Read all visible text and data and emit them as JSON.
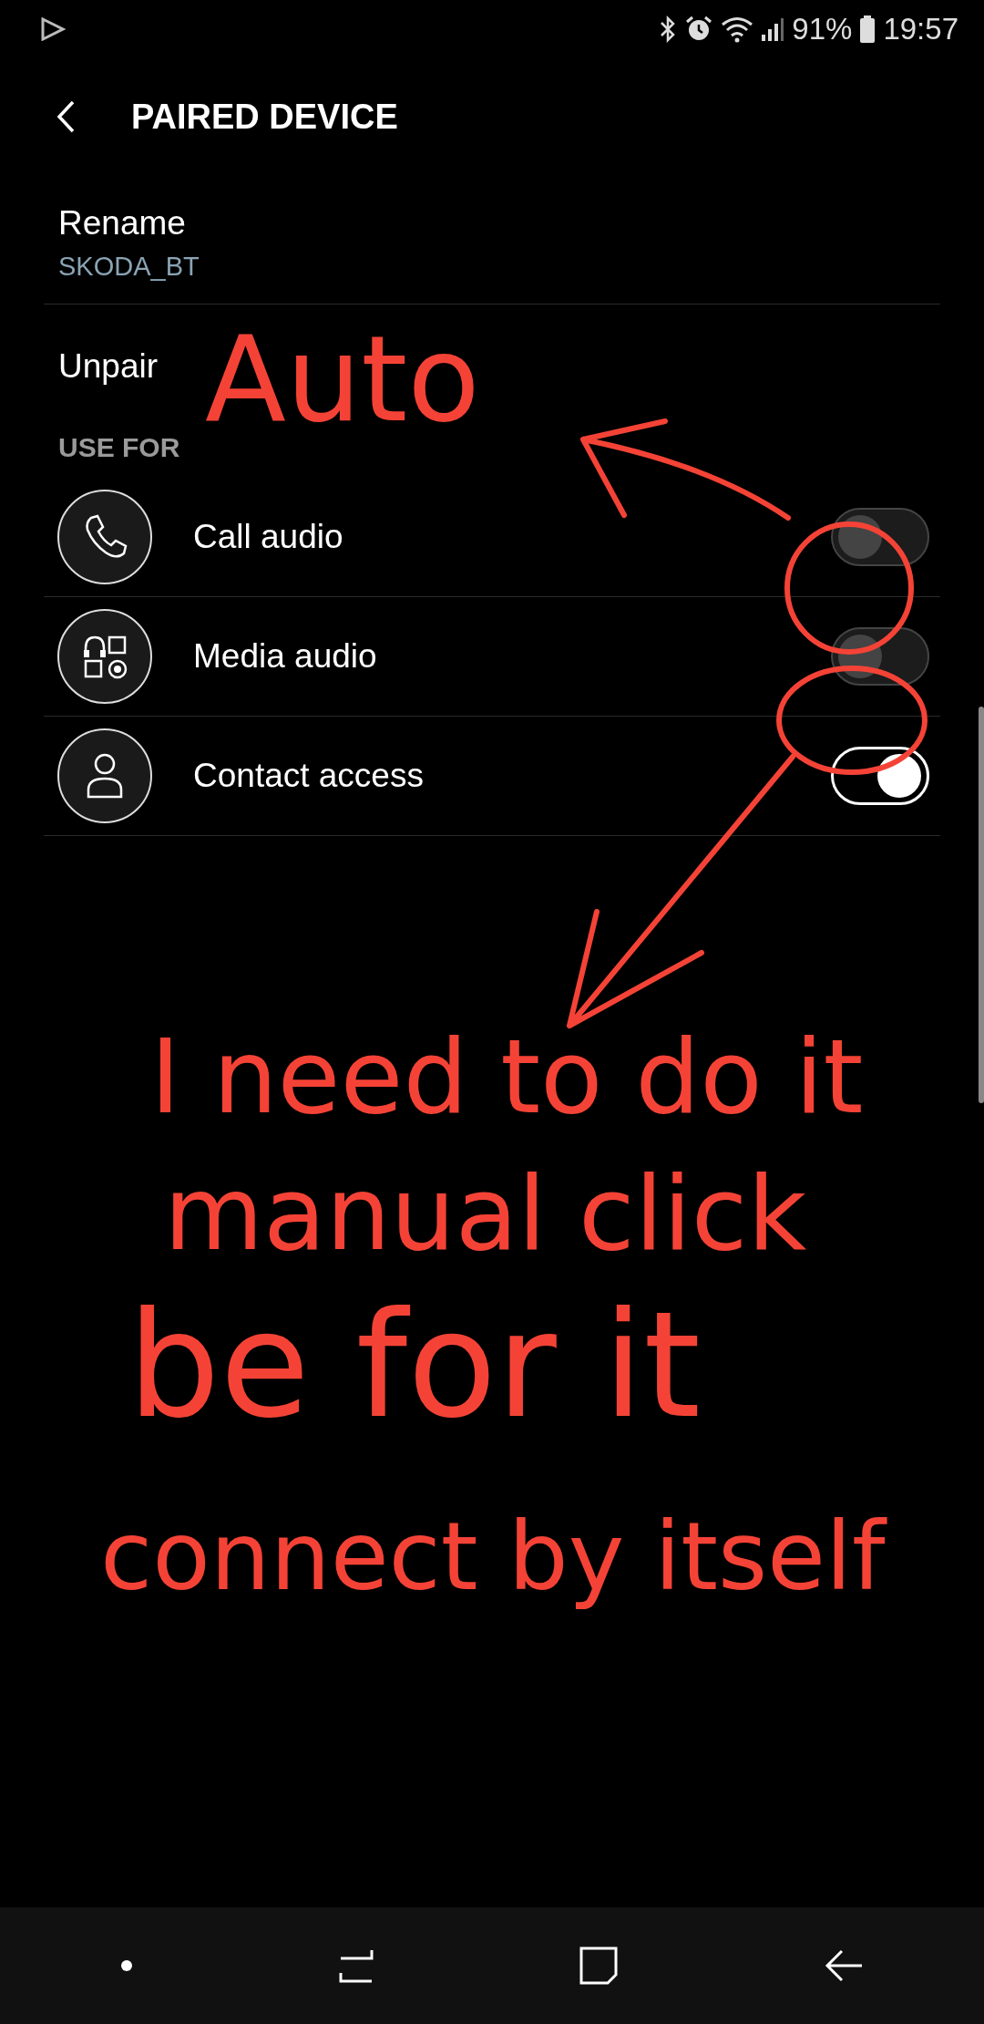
{
  "status_bar": {
    "battery": "91%",
    "time": "19:57"
  },
  "header": {
    "title": "PAIRED DEVICE"
  },
  "rename": {
    "label": "Rename",
    "value": "SKODA_BT"
  },
  "unpair": {
    "label": "Unpair"
  },
  "section": {
    "title": "USE FOR"
  },
  "options": [
    {
      "kind": "phone",
      "label": "Call audio",
      "on": false
    },
    {
      "kind": "media",
      "label": "Media audio",
      "on": false
    },
    {
      "kind": "contact",
      "label": "Contact access",
      "on": true
    }
  ],
  "annotations": [
    {
      "text": "Auto"
    },
    {
      "text": "I need to do it"
    },
    {
      "text": "manual click"
    },
    {
      "text": "be for it"
    },
    {
      "text": "connect by itself"
    }
  ]
}
